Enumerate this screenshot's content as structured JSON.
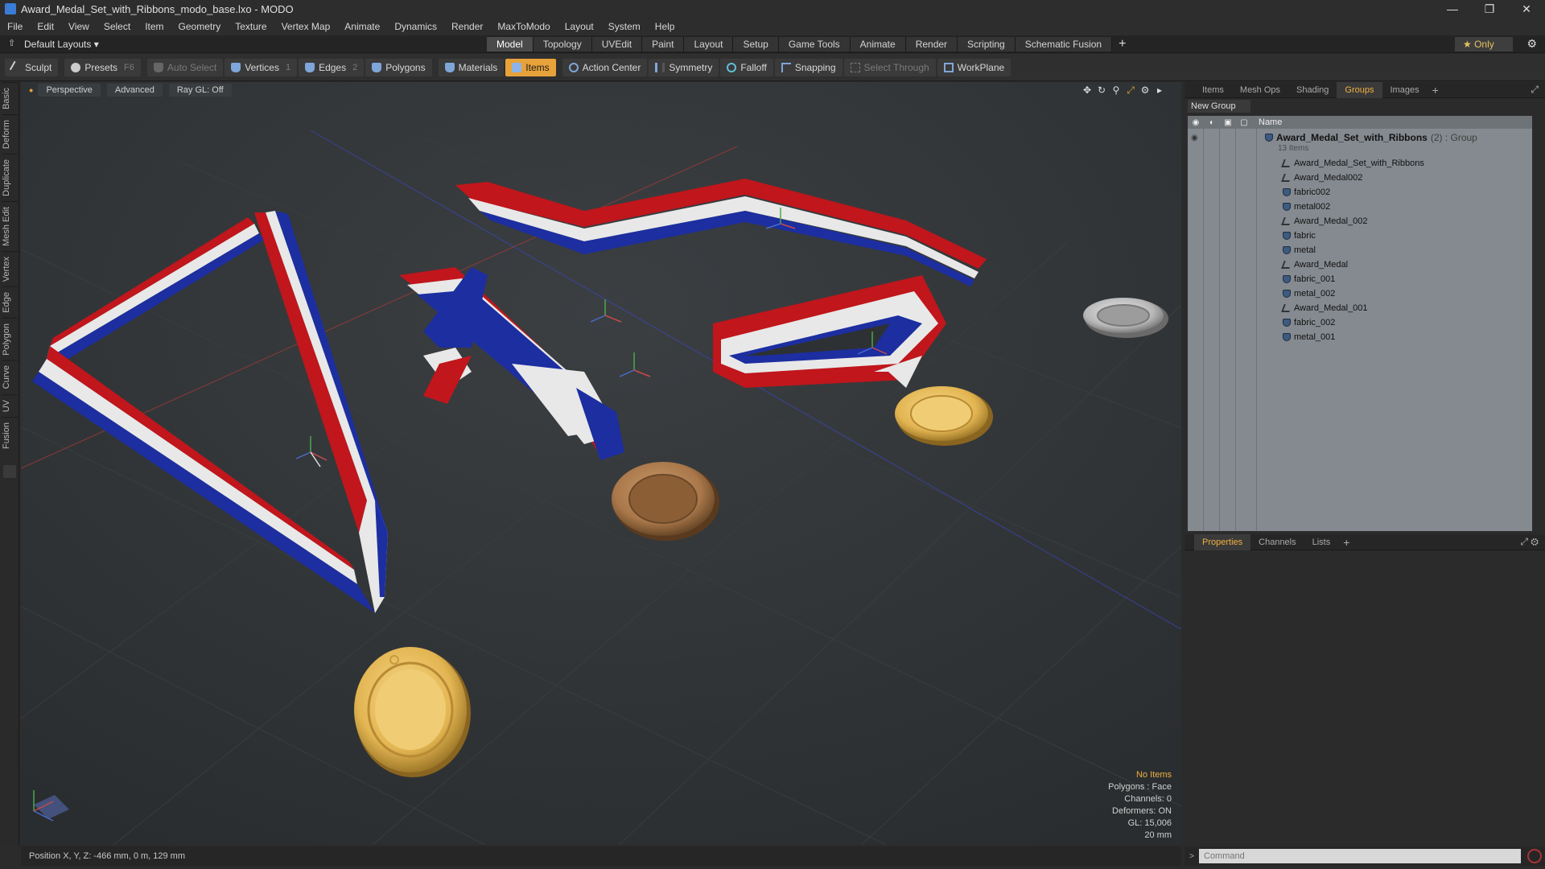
{
  "window": {
    "title": "Award_Medal_Set_with_Ribbons_modo_base.lxo - MODO",
    "controls": [
      "—",
      "❐",
      "✕"
    ]
  },
  "menu": [
    "File",
    "Edit",
    "View",
    "Select",
    "Item",
    "Geometry",
    "Texture",
    "Vertex Map",
    "Animate",
    "Dynamics",
    "Render",
    "MaxToModo",
    "Layout",
    "System",
    "Help"
  ],
  "layoutbar": {
    "layout": "Default Layouts ▾",
    "tabs": [
      "Model",
      "Topology",
      "UVEdit",
      "Paint",
      "Layout",
      "Setup",
      "Game Tools",
      "Animate",
      "Render",
      "Scripting",
      "Schematic Fusion"
    ],
    "active_tab": "Model",
    "add": "+",
    "only": "★  Only"
  },
  "toolbar": {
    "sculpt": "Sculpt",
    "presets": "Presets",
    "presets_key": "F6",
    "auto_select": "Auto Select",
    "vertices": "Vertices",
    "vertices_count": "1",
    "edges": "Edges",
    "edges_count": "2",
    "polygons": "Polygons",
    "materials": "Materials",
    "items": "Items",
    "action_center": "Action Center",
    "symmetry": "Symmetry",
    "falloff": "Falloff",
    "snapping": "Snapping",
    "select_through": "Select Through",
    "workplane": "WorkPlane"
  },
  "left_tabs": [
    "Basic",
    "Deform",
    "Duplicate",
    "Mesh Edit",
    "Vertex",
    "Edge",
    "Polygon",
    "Curve",
    "UV",
    "Fusion"
  ],
  "viewport": {
    "perspective": "Perspective",
    "advanced": "Advanced",
    "raygl": "Ray GL: Off",
    "info": {
      "no_items": "No Items",
      "polygons": "Polygons : Face",
      "channels": "Channels: 0",
      "deformers": "Deformers: ON",
      "gl": "GL: 15,006",
      "scale": "20 mm"
    }
  },
  "status": "Position X, Y, Z:  -466 mm, 0 m, 129 mm",
  "groups_panel": {
    "tabs": [
      "Items",
      "Mesh Ops",
      "Shading",
      "Groups",
      "Images"
    ],
    "active_tab": "Groups",
    "new_group": "New Group",
    "name_header": "Name",
    "group_name": "Award_Medal_Set_with_Ribbons",
    "group_suffix": "(2) : Group",
    "group_count": "13 Items",
    "items": [
      {
        "name": "Award_Medal_Set_with_Ribbons",
        "kind": "mesh"
      },
      {
        "name": "Award_Medal002",
        "kind": "mesh"
      },
      {
        "name": "fabric002",
        "kind": "material"
      },
      {
        "name": "metal002",
        "kind": "material"
      },
      {
        "name": "Award_Medal_002",
        "kind": "mesh"
      },
      {
        "name": "fabric",
        "kind": "material"
      },
      {
        "name": "metal",
        "kind": "material"
      },
      {
        "name": "Award_Medal",
        "kind": "mesh"
      },
      {
        "name": "fabric_001",
        "kind": "material"
      },
      {
        "name": "metal_002",
        "kind": "material"
      },
      {
        "name": "Award_Medal_001",
        "kind": "mesh"
      },
      {
        "name": "fabric_002",
        "kind": "material"
      },
      {
        "name": "metal_001",
        "kind": "material"
      }
    ]
  },
  "props_panel": {
    "tabs": [
      "Properties",
      "Channels",
      "Lists"
    ],
    "active_tab": "Properties"
  },
  "command": {
    "placeholder": "Command"
  },
  "colors": {
    "accent": "#f0b040",
    "active_tool": "#e8a23a",
    "ribbon_red": "#c0161c",
    "ribbon_blue": "#1c2ea0",
    "gold": "#e3b552",
    "bronze": "#a9774a",
    "silver": "#b8b8b8"
  }
}
